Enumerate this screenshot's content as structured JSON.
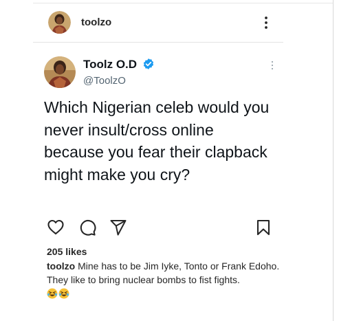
{
  "post": {
    "username": "toolzo",
    "more_icon": "more-vertical-icon"
  },
  "tweet": {
    "display_name": "Toolz O.D",
    "handle": "@ToolzO",
    "verified": true,
    "text": "Which Nigerian celeb would you never insult/cross online because you fear their clapback might make you cry?"
  },
  "actions": {
    "icons": [
      "heart-icon",
      "comment-icon",
      "share-icon",
      "bookmark-icon"
    ]
  },
  "likes_text": "205 likes",
  "caption": {
    "username": "toolzo",
    "text_line1": " Mine has to be Jim Iyke, Tonto or Frank Edoho.",
    "text_line2": "They like to bring nuclear bombs to fist fights.",
    "emojis": [
      "rolling-on-floor-laughing-emoji",
      "rolling-on-floor-laughing-emoji"
    ]
  },
  "colors": {
    "verified": "#1d9bf0",
    "handle": "#536471",
    "text": "#0f1419"
  }
}
